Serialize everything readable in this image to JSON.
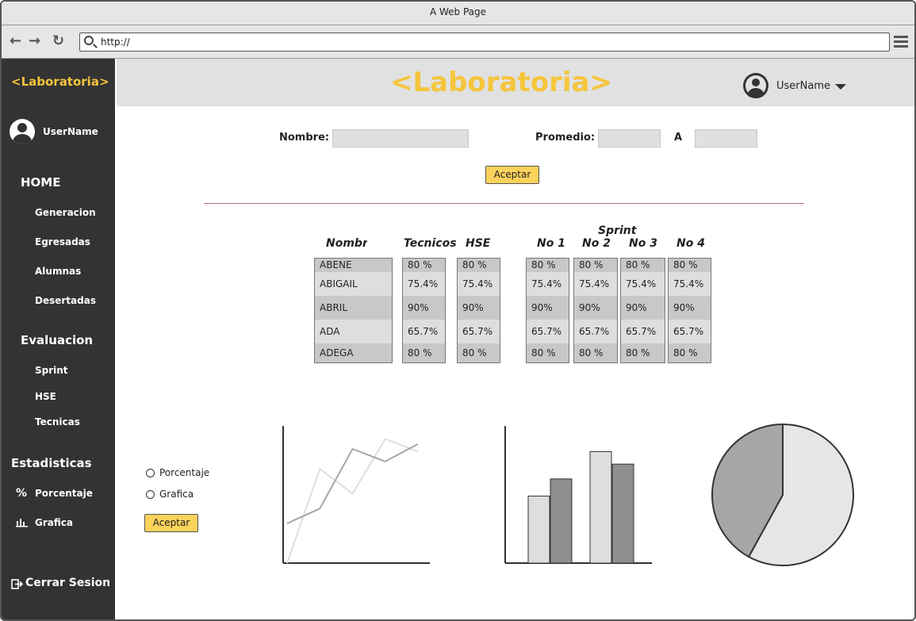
{
  "browser": {
    "title": "A Web Page",
    "url": "http://"
  },
  "sidebar": {
    "logo": "<Laboratoria>",
    "username": "UserName",
    "home": {
      "heading": "HOME",
      "items": [
        "Generacion",
        "Egresadas",
        "Alumnas",
        "Desertadas"
      ]
    },
    "evaluacion": {
      "heading": "Evaluacion",
      "items": [
        "Sprint",
        "HSE",
        "Tecnicas"
      ]
    },
    "estadisticas": {
      "heading": "Estadisticas",
      "porcentaje": "Porcentaje",
      "grafica": "Grafica",
      "percent_symbol": "%"
    },
    "logout": "Cerrar Sesion"
  },
  "header": {
    "logo": "<Laboratoria>",
    "username": "UserName"
  },
  "filter": {
    "nombre_label": "Nombre:",
    "promedio_label": "Promedio:",
    "a_label": "A",
    "accept": "Aceptar"
  },
  "table": {
    "headers": {
      "nombre": "Nombr",
      "tecnicos": "Tecnicos",
      "hse": "HSE",
      "sprint": "Sprint",
      "no1": "No 1",
      "no2": "No 2",
      "no3": "No 3",
      "no4": "No 4"
    },
    "names": [
      "ABENE",
      "ABIGAIL",
      "ABRIL",
      "ADA",
      "ADEGA"
    ],
    "values": [
      "80 %",
      "75.4%",
      "90%",
      "65.7%",
      "80 %"
    ]
  },
  "stats": {
    "options": [
      "Porcentaje",
      "Grafica"
    ],
    "accept": "Aceptar"
  },
  "colors": {
    "accent": "#fbd25b",
    "logo": "#f5c53c",
    "sidebar": "#333333"
  },
  "chart_data": [
    {
      "type": "line",
      "x": [
        1,
        2,
        3,
        4,
        5
      ],
      "series": [
        {
          "values": [
            0,
            38,
            28,
            50,
            45
          ]
        },
        {
          "values": [
            16,
            22,
            46,
            41,
            48
          ]
        }
      ],
      "ylim": [
        0,
        55
      ],
      "title": "",
      "xlabel": "",
      "ylabel": ""
    },
    {
      "type": "bar",
      "categories": [
        "1",
        "2"
      ],
      "series": [
        {
          "values": [
            86,
            143
          ]
        },
        {
          "values": [
            108,
            127
          ]
        }
      ],
      "ylim": [
        0,
        175
      ],
      "title": "",
      "xlabel": "",
      "ylabel": ""
    },
    {
      "type": "pie",
      "values": [
        58,
        42
      ],
      "title": ""
    }
  ]
}
